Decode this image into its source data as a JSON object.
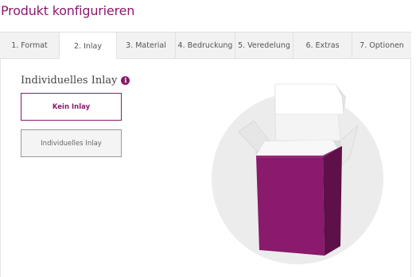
{
  "header": {
    "title": "Produkt konfigurieren"
  },
  "tabs": [
    {
      "label": "1. Format"
    },
    {
      "label": "2. Inlay"
    },
    {
      "label": "3. Material"
    },
    {
      "label": "4. Bedruckung"
    },
    {
      "label": "5. Veredelung"
    },
    {
      "label": "6. Extras"
    },
    {
      "label": "7. Optionen"
    }
  ],
  "active_tab": "2. Inlay",
  "inlay": {
    "heading": "Individuelles Inlay",
    "info_icon": "info-icon",
    "options": [
      {
        "label": "Kein Inlay",
        "selected": true
      },
      {
        "label": "Individuelles Inlay",
        "selected": false
      }
    ]
  },
  "preview": {
    "image": "purple-box-3d",
    "box_color": "#8a1a6b"
  },
  "colors": {
    "accent": "#8a1a6b",
    "tab_background": "#f2f2f2",
    "border": "#e1e1e1"
  }
}
